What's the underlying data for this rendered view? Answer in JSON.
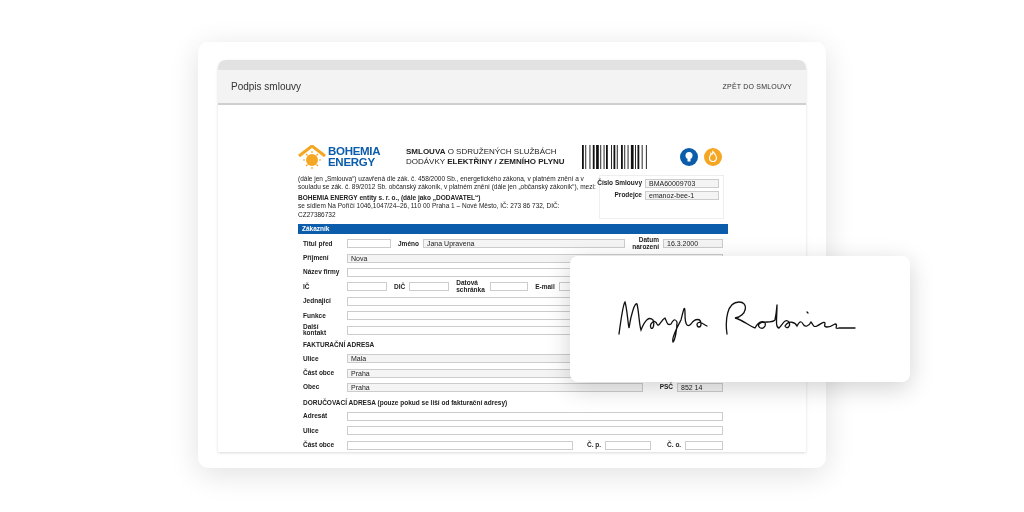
{
  "window": {
    "title": "Podpis smlouvy",
    "back_link": "ZPĚT DO SMLOUVY"
  },
  "document": {
    "logo": "BOHEMIA ENERGY",
    "title_lines": [
      "**SMLOUVA** O SDRUŽENÝCH SLUŽBÁCH",
      "DODÁVKY **ELEKTŘINY / ZEMNÍHO PLYNU**"
    ],
    "intro": "(dále jen „Smlouva“) uzavřená dle zák. č. 458/2000 Sb., energetického zákona, v platném znění a v souladu se zák. č. 89/2012 Sb. občanský zákoník, v platném znění (dále jen „občanský zákoník“), mezi:",
    "supplier": "BOHEMIA ENERGY entity s. r. o., (dále jako „DODAVATEL“)",
    "supplier_address": "se sídlem Na Poříčí 1046,1047/24–26, 110 00 Praha 1 – Nové Město, IČ: 273 86 732, DIČ: CZ27386732",
    "meta": [
      {
        "label": "Číslo Smlouvy",
        "value": "BMA60009703"
      },
      {
        "label": "Prodejce",
        "value": "emanoz-bee-1"
      }
    ],
    "section": "Zákazník",
    "rows": [
      {
        "kind": "name",
        "fields": [
          {
            "label": "Titul před"
          },
          {
            "label": "Jméno",
            "value": "Jana Upravena"
          },
          {
            "label": "Datum narození",
            "value": "16.3.2000"
          }
        ]
      },
      {
        "kind": "wide",
        "fields": [
          {
            "label": "Příjmení",
            "value": "Nova"
          }
        ]
      },
      {
        "kind": "wide",
        "fields": [
          {
            "label": "Název firmy"
          }
        ]
      },
      {
        "kind": "ids",
        "fields": [
          {
            "label": "IČ"
          },
          {
            "label": "DIČ"
          },
          {
            "label": "Datová schránka"
          },
          {
            "label": "E-mail"
          }
        ]
      },
      {
        "kind": "wide",
        "fields": [
          {
            "label": "Jednající"
          }
        ]
      },
      {
        "kind": "wide",
        "fields": [
          {
            "label": "Funkce"
          }
        ]
      },
      {
        "kind": "wide",
        "fields": [
          {
            "label": "Další kontakt"
          }
        ]
      },
      {
        "kind": "heading",
        "text": "FAKTURAČNÍ ADRESA"
      },
      {
        "kind": "wide",
        "fields": [
          {
            "label": "Ulice",
            "value": "Mala"
          }
        ]
      },
      {
        "kind": "wide",
        "fields": [
          {
            "label": "Část obce",
            "value": "Praha"
          }
        ]
      },
      {
        "kind": "city",
        "fields": [
          {
            "label": "Obec",
            "value": "Praha"
          },
          {
            "label": "PSČ",
            "value": "852 14"
          }
        ]
      },
      {
        "kind": "heading",
        "text": "DORUČOVACÍ ADRESA (pouze pokud se liší od fakturační adresy)"
      },
      {
        "kind": "wide",
        "fields": [
          {
            "label": "Adresát"
          }
        ]
      },
      {
        "kind": "wide",
        "fields": [
          {
            "label": "Ulice"
          }
        ]
      },
      {
        "kind": "street",
        "fields": [
          {
            "label": "Část obce"
          },
          {
            "label": "Č. p."
          },
          {
            "label": "Č. o."
          }
        ]
      }
    ]
  }
}
